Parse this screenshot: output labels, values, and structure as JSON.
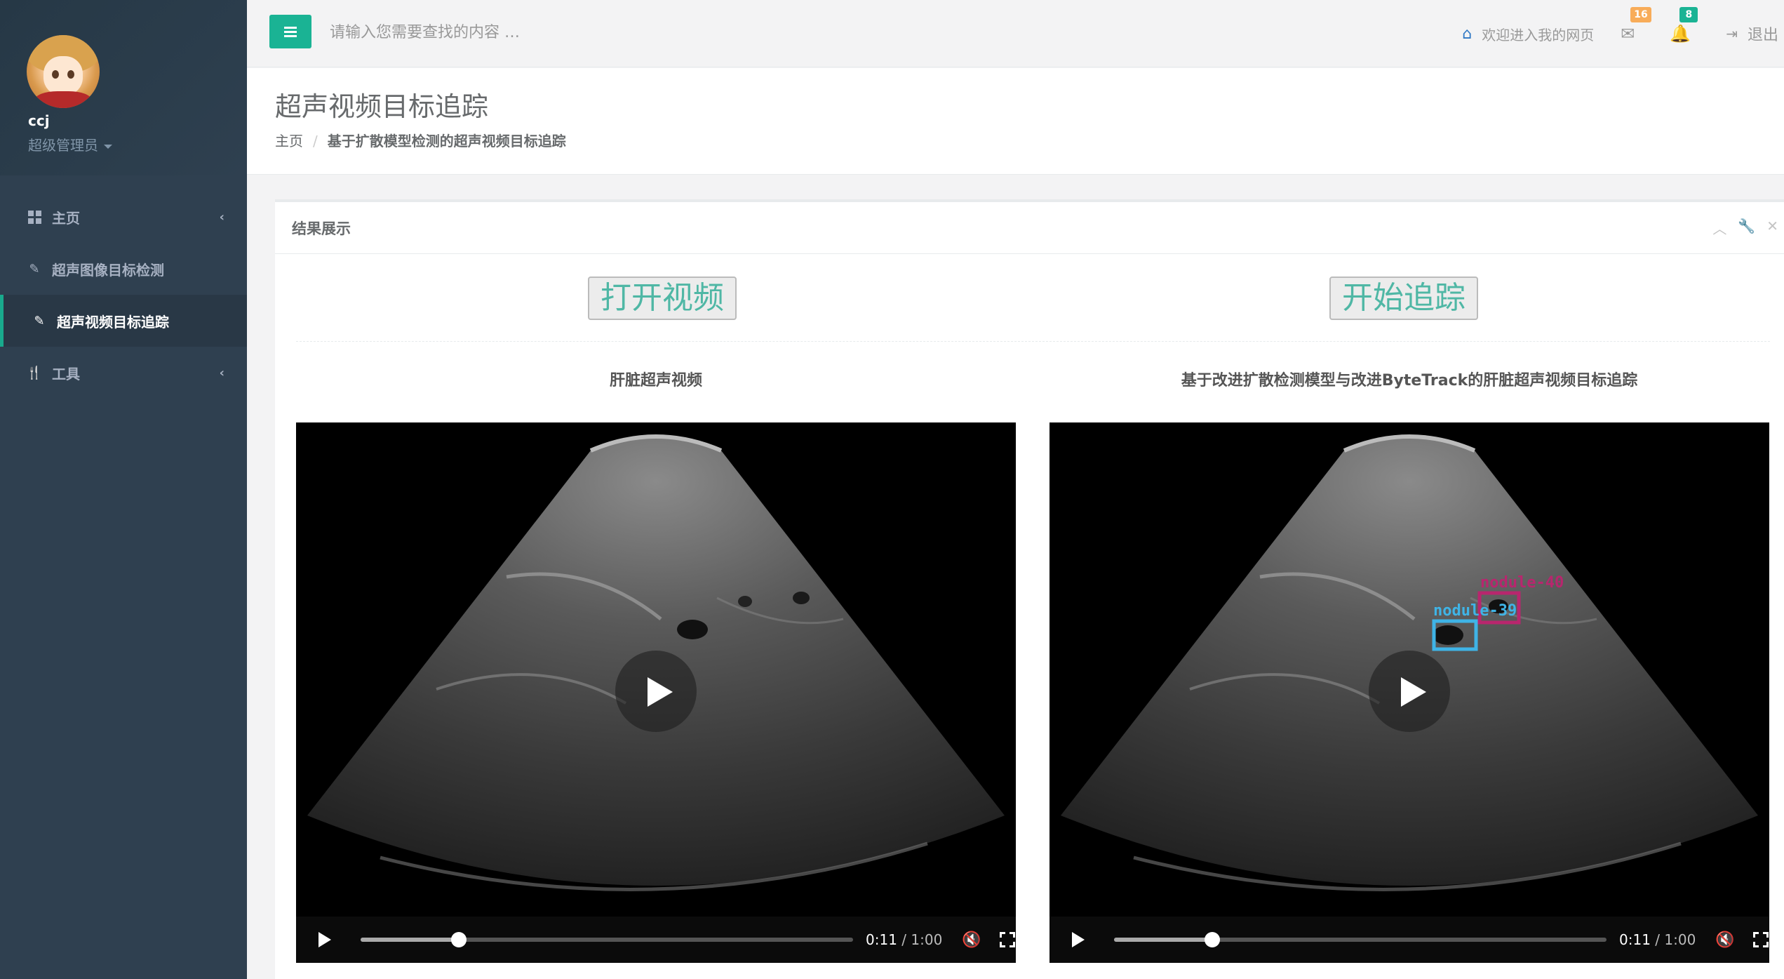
{
  "sidebar": {
    "username": "ccj",
    "role": "超级管理员",
    "items": [
      {
        "label": "主页",
        "icon": "grid-icon"
      },
      {
        "label": "超声图像目标检测",
        "icon": "magic-wand-icon"
      },
      {
        "label": "超声视频目标追踪",
        "icon": "magic-wand-icon"
      },
      {
        "label": "工具",
        "icon": "cutlery-icon"
      }
    ]
  },
  "topbar": {
    "search_placeholder": "请输入您需要查找的内容 …",
    "welcome": "欢迎进入我的网页",
    "mail_count": "16",
    "bell_count": "8",
    "logout": "退出"
  },
  "page": {
    "title": "超声视频目标追踪",
    "breadcrumb_home": "主页",
    "breadcrumb_current": "基于扩散模型检测的超声视频目标追踪"
  },
  "panel": {
    "title": "结果展示",
    "open_video_button": "打开视频",
    "start_tracking_button": "开始追踪",
    "left_video_title": "肝脏超声视频",
    "right_video_title": "基于改进扩散检测模型与改进ByteTrack的肝脏超声视频目标追踪"
  },
  "videos": {
    "left": {
      "current_time": "0:11",
      "duration": "/ 1:00",
      "progress": 0.2
    },
    "right": {
      "current_time": "0:11",
      "duration": "/ 1:00",
      "progress": 0.2,
      "detections": [
        {
          "label": "nodule-40",
          "color": "#b8266e"
        },
        {
          "label": "nodule-39",
          "color": "#3fb4e6"
        }
      ]
    }
  },
  "colors": {
    "accent": "#1ab394",
    "sidebar": "#2f4050",
    "badge_orange": "#f8ac59"
  }
}
